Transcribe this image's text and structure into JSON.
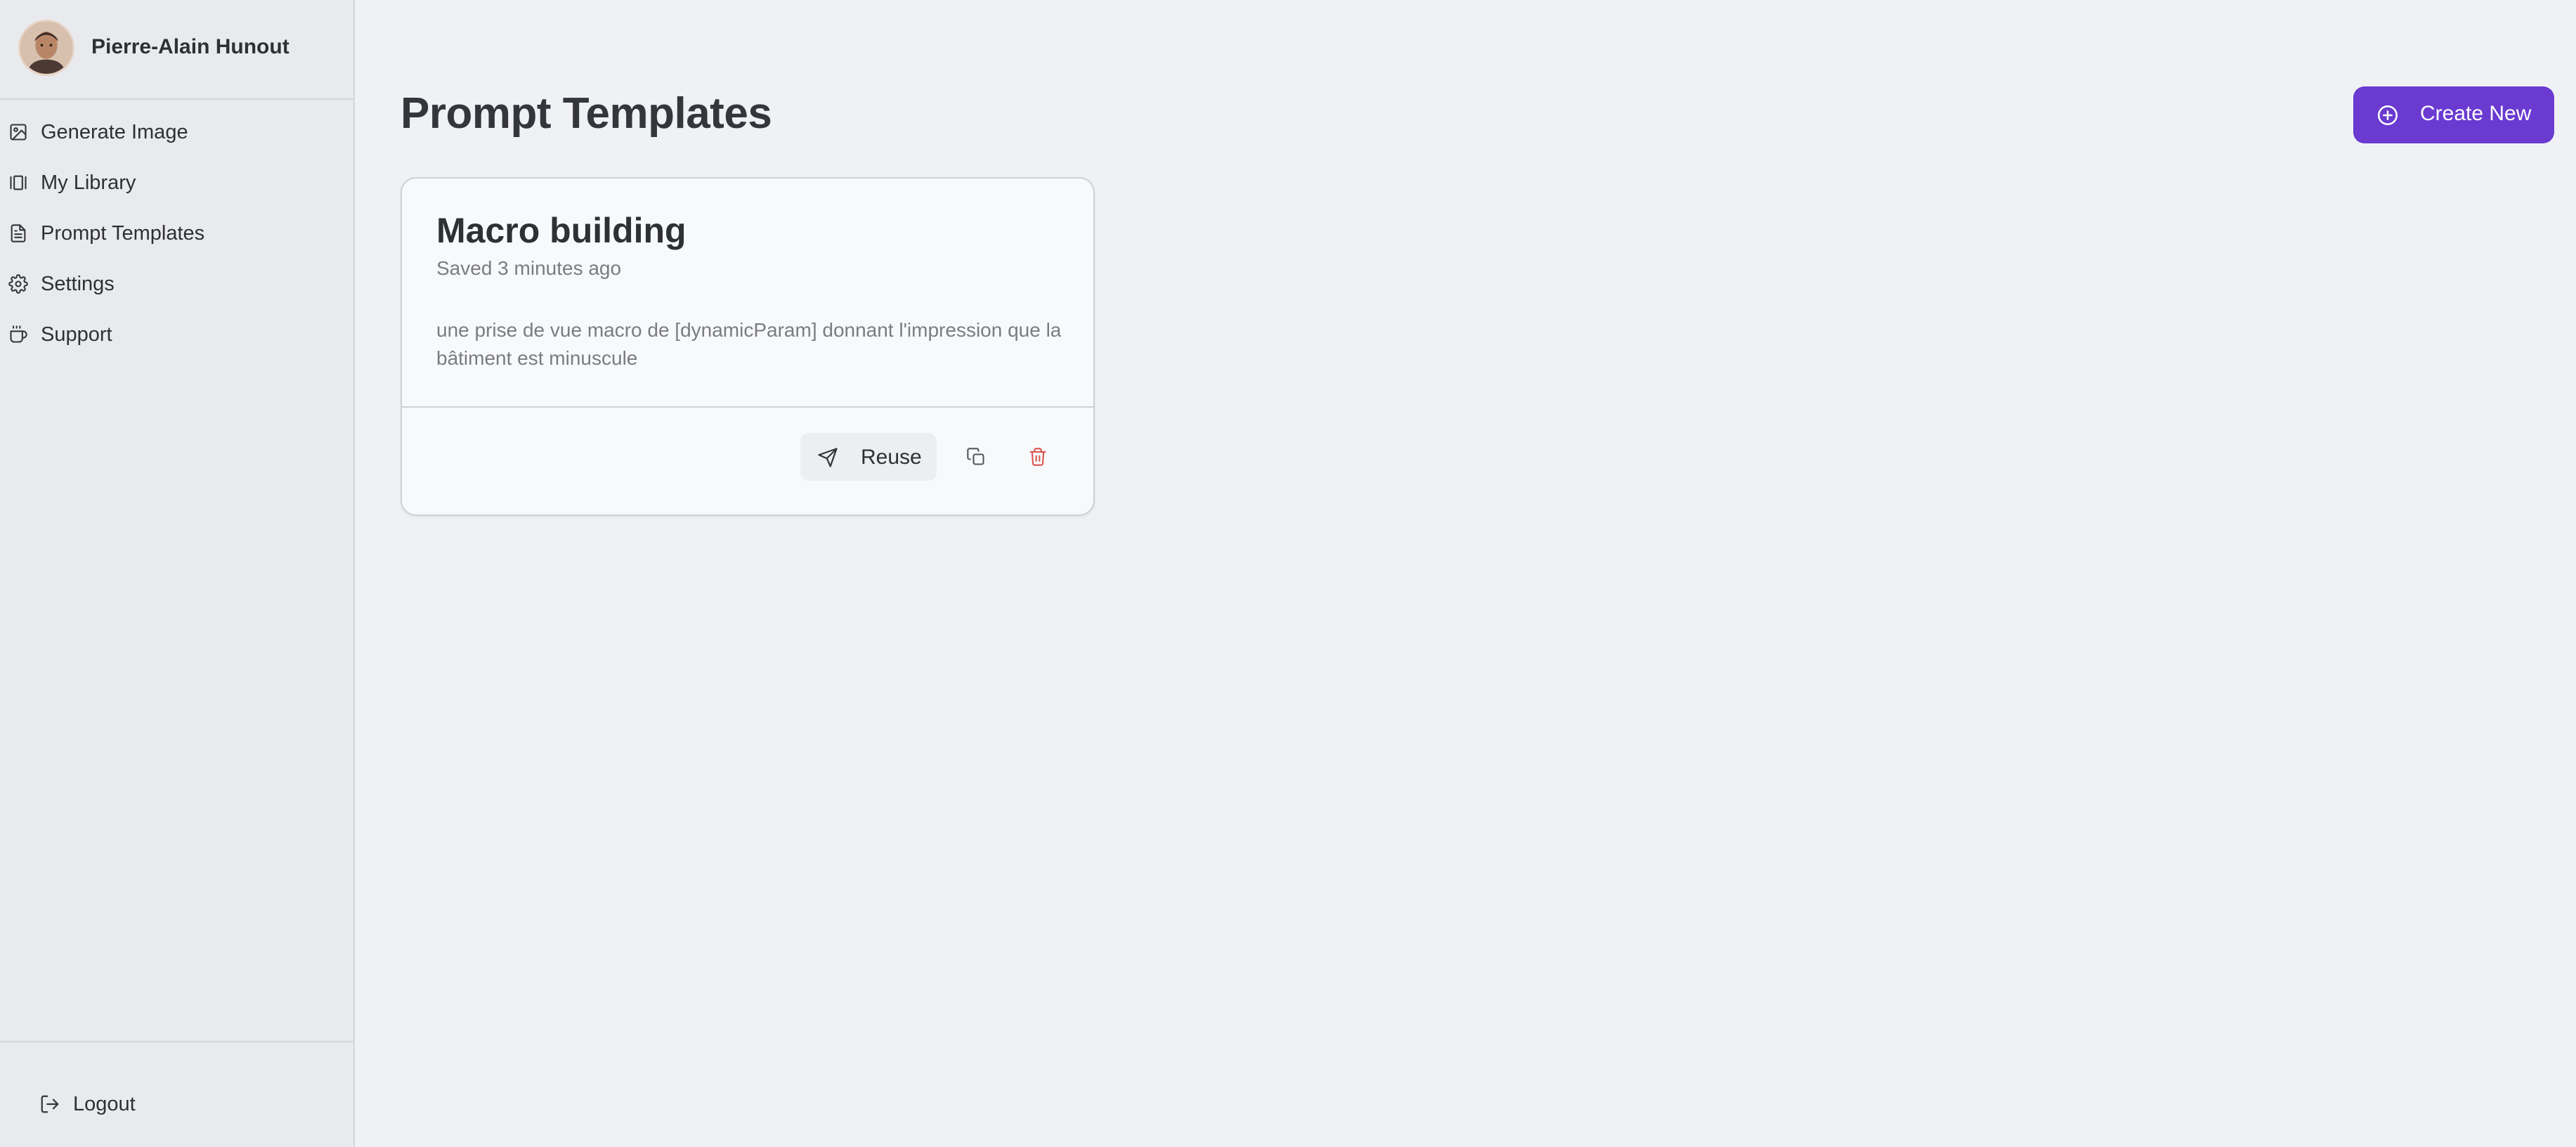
{
  "user": {
    "name": "Pierre-Alain Hunout"
  },
  "sidebar": {
    "items": [
      {
        "label": "Generate Image",
        "icon": "image-icon"
      },
      {
        "label": "My Library",
        "icon": "library-icon"
      },
      {
        "label": "Prompt Templates",
        "icon": "document-icon"
      },
      {
        "label": "Settings",
        "icon": "gear-icon"
      },
      {
        "label": "Support",
        "icon": "coffee-cup-icon"
      }
    ],
    "logout_label": "Logout"
  },
  "main": {
    "title": "Prompt Templates",
    "create_label": "Create New",
    "templates": [
      {
        "title": "Macro building",
        "saved": "Saved 3 minutes ago",
        "prompt": "une prise de vue macro de [dynamicParam] donnant l'impression que la bâtiment est minuscule",
        "reuse_label": "Reuse"
      }
    ]
  },
  "colors": {
    "accent": "#6a3ad1",
    "danger": "#d9534f",
    "background": "#f0f1f5",
    "sidebar": "#e9eaee"
  }
}
